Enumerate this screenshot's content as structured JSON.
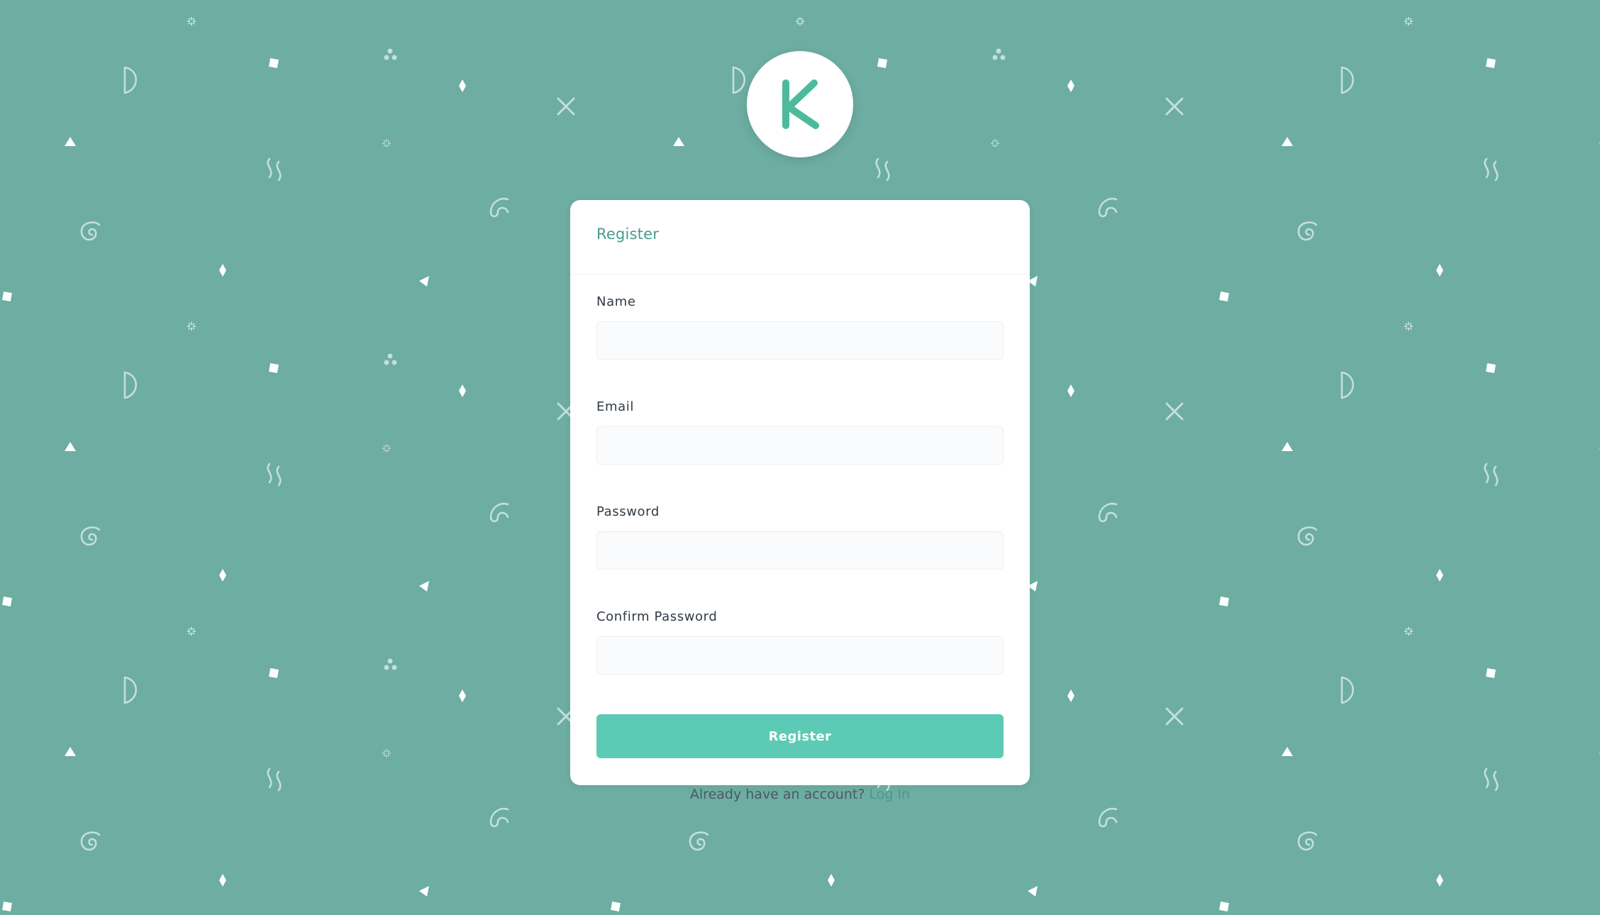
{
  "brand": {
    "logo_letter": "K",
    "logo_color": "#4dba9e",
    "background_color": "#6dada2",
    "accent_color": "#5ccab5"
  },
  "register_form": {
    "title": "Register",
    "fields": [
      {
        "label": "Name",
        "value": ""
      },
      {
        "label": "Email",
        "value": ""
      },
      {
        "label": "Password",
        "value": ""
      },
      {
        "label": "Confirm Password",
        "value": ""
      }
    ],
    "submit_label": "Register",
    "login_prompt": "Already have an account?",
    "login_link": "Log In"
  }
}
